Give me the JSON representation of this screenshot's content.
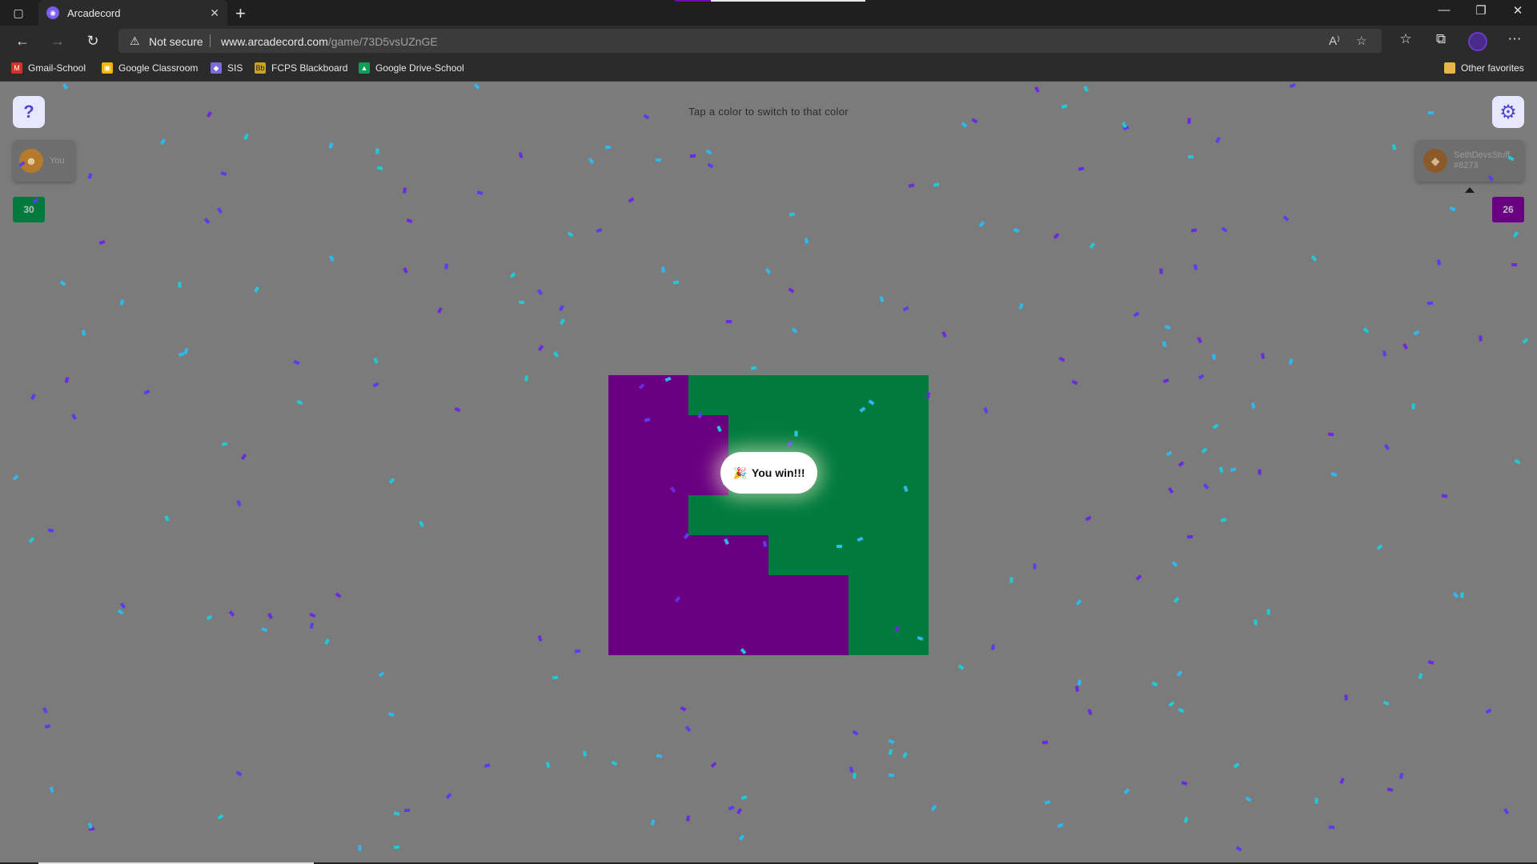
{
  "browser": {
    "tab_title": "Arcadecord",
    "security_label": "Not secure",
    "url_domain": "www.arcadecord.com",
    "url_path": "/game/73D5vsUZnGE",
    "bookmarks": [
      {
        "label": "Gmail-School",
        "icon": "gmail-icon",
        "color": "#d93025"
      },
      {
        "label": "Google Classroom",
        "icon": "classroom-icon",
        "color": "#f4b400"
      },
      {
        "label": "SIS",
        "icon": "sis-icon",
        "color": "#7a6bd6"
      },
      {
        "label": "FCPS Blackboard",
        "icon": "blackboard-icon",
        "color": "#c9a227"
      },
      {
        "label": "Google Drive-School",
        "icon": "drive-icon",
        "color": "#0f9d58"
      }
    ],
    "other_favorites": "Other favorites"
  },
  "game": {
    "hint": "Tap a color to switch to that color",
    "help_label": "?",
    "win_message": "You win!!!",
    "player_you": {
      "name": "You",
      "score": "30",
      "color": "#017a3e"
    },
    "player_opponent": {
      "name": "SethDevsStuff",
      "tag": "#8273",
      "score": "26",
      "color": "#6a0081"
    },
    "board": {
      "cols": 8,
      "rows": 7,
      "colors": {
        "P": "#6a0081",
        "G": "#017a3e"
      },
      "grid": [
        "PPGGGGGG",
        "PPPGGGGG",
        "PPPGGGGG",
        "PPGGGGGG",
        "PPPPGGGG",
        "PPPPPPGG",
        "PPPPPPGG"
      ]
    },
    "confetti_colors": [
      "#2fb8f0",
      "#5b3cf0",
      "#20c8d8",
      "#6b2ae0"
    ]
  }
}
